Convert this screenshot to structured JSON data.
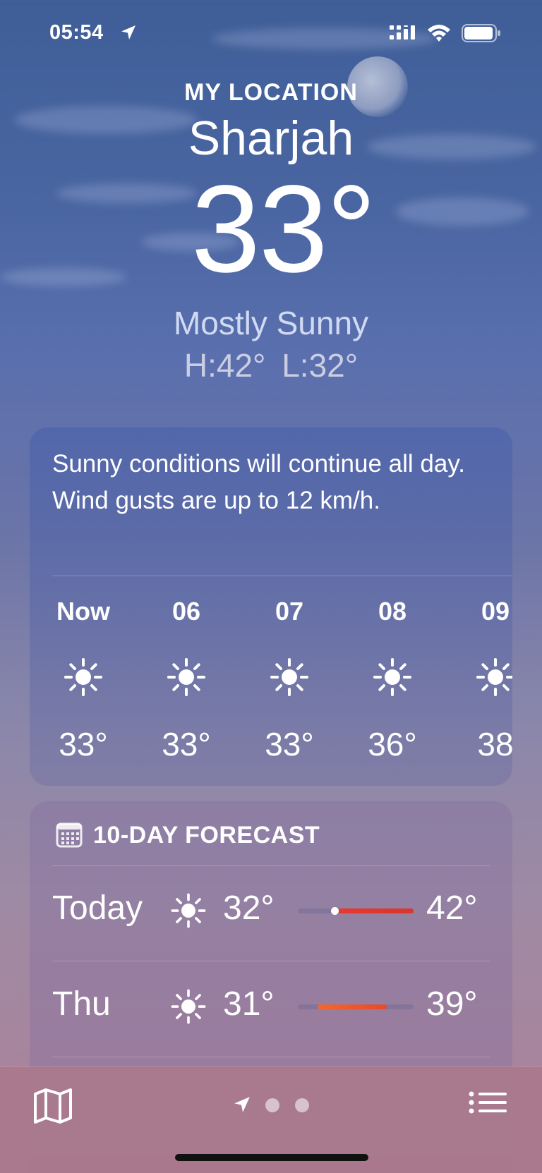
{
  "status_bar": {
    "time": "05:54",
    "location_icon": "location-arrow-icon",
    "signal_icon": "cellular-signal-icon",
    "wifi_icon": "wifi-icon",
    "battery_icon": "battery-icon"
  },
  "header": {
    "location_label": "MY LOCATION",
    "city": "Sharjah",
    "temperature": "33°",
    "condition": "Mostly Sunny",
    "high_low": "H:42° L:32°"
  },
  "hourly": {
    "summary": "Sunny conditions will continue all day. Wind gusts are up to 12 km/h.",
    "hours": [
      {
        "label": "Now",
        "icon": "sun-icon",
        "temp": "33°"
      },
      {
        "label": "06",
        "icon": "sun-icon",
        "temp": "33°"
      },
      {
        "label": "07",
        "icon": "sun-icon",
        "temp": "33°"
      },
      {
        "label": "08",
        "icon": "sun-icon",
        "temp": "36°"
      },
      {
        "label": "09",
        "icon": "sun-icon",
        "temp": "38"
      }
    ]
  },
  "forecast": {
    "title": "10-DAY FORECAST",
    "icon": "calendar-icon",
    "days": [
      {
        "day": "Today",
        "icon": "sun-icon",
        "low": "32°",
        "high": "42°",
        "range_start": 0.35,
        "range_end": 1.0,
        "current": 0.32,
        "color_start": "#e8392e",
        "color_end": "#d9362f"
      },
      {
        "day": "Thu",
        "icon": "sun-icon",
        "low": "31°",
        "high": "39°",
        "range_start": 0.17,
        "range_end": 0.77,
        "color_start": "#f0682f",
        "color_end": "#e64a2e"
      }
    ]
  },
  "bottom_bar": {
    "map_icon": "map-icon",
    "location_icon": "location-arrow-icon",
    "page_count": 3,
    "list_icon": "list-icon"
  },
  "colors": {
    "sky_top": "#3f5e98",
    "sky_bottom": "#ad8098",
    "condition_text": "#dfe6fb"
  }
}
